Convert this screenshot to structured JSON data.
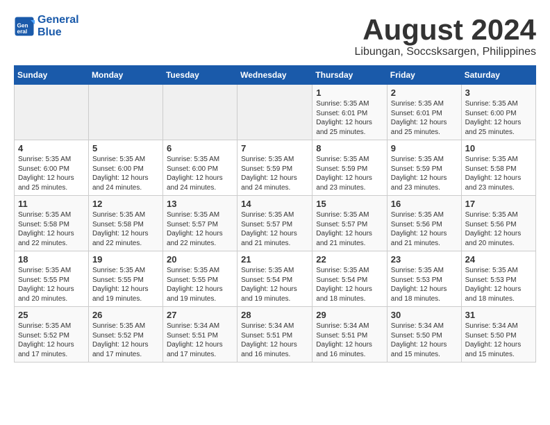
{
  "header": {
    "logo_line1": "General",
    "logo_line2": "Blue",
    "title": "August 2024",
    "subtitle": "Libungan, Soccsksargen, Philippines"
  },
  "weekdays": [
    "Sunday",
    "Monday",
    "Tuesday",
    "Wednesday",
    "Thursday",
    "Friday",
    "Saturday"
  ],
  "weeks": [
    [
      {
        "day": "",
        "info": ""
      },
      {
        "day": "",
        "info": ""
      },
      {
        "day": "",
        "info": ""
      },
      {
        "day": "",
        "info": ""
      },
      {
        "day": "1",
        "info": "Sunrise: 5:35 AM\nSunset: 6:01 PM\nDaylight: 12 hours\nand 25 minutes."
      },
      {
        "day": "2",
        "info": "Sunrise: 5:35 AM\nSunset: 6:01 PM\nDaylight: 12 hours\nand 25 minutes."
      },
      {
        "day": "3",
        "info": "Sunrise: 5:35 AM\nSunset: 6:00 PM\nDaylight: 12 hours\nand 25 minutes."
      }
    ],
    [
      {
        "day": "4",
        "info": "Sunrise: 5:35 AM\nSunset: 6:00 PM\nDaylight: 12 hours\nand 25 minutes."
      },
      {
        "day": "5",
        "info": "Sunrise: 5:35 AM\nSunset: 6:00 PM\nDaylight: 12 hours\nand 24 minutes."
      },
      {
        "day": "6",
        "info": "Sunrise: 5:35 AM\nSunset: 6:00 PM\nDaylight: 12 hours\nand 24 minutes."
      },
      {
        "day": "7",
        "info": "Sunrise: 5:35 AM\nSunset: 5:59 PM\nDaylight: 12 hours\nand 24 minutes."
      },
      {
        "day": "8",
        "info": "Sunrise: 5:35 AM\nSunset: 5:59 PM\nDaylight: 12 hours\nand 23 minutes."
      },
      {
        "day": "9",
        "info": "Sunrise: 5:35 AM\nSunset: 5:59 PM\nDaylight: 12 hours\nand 23 minutes."
      },
      {
        "day": "10",
        "info": "Sunrise: 5:35 AM\nSunset: 5:58 PM\nDaylight: 12 hours\nand 23 minutes."
      }
    ],
    [
      {
        "day": "11",
        "info": "Sunrise: 5:35 AM\nSunset: 5:58 PM\nDaylight: 12 hours\nand 22 minutes."
      },
      {
        "day": "12",
        "info": "Sunrise: 5:35 AM\nSunset: 5:58 PM\nDaylight: 12 hours\nand 22 minutes."
      },
      {
        "day": "13",
        "info": "Sunrise: 5:35 AM\nSunset: 5:57 PM\nDaylight: 12 hours\nand 22 minutes."
      },
      {
        "day": "14",
        "info": "Sunrise: 5:35 AM\nSunset: 5:57 PM\nDaylight: 12 hours\nand 21 minutes."
      },
      {
        "day": "15",
        "info": "Sunrise: 5:35 AM\nSunset: 5:57 PM\nDaylight: 12 hours\nand 21 minutes."
      },
      {
        "day": "16",
        "info": "Sunrise: 5:35 AM\nSunset: 5:56 PM\nDaylight: 12 hours\nand 21 minutes."
      },
      {
        "day": "17",
        "info": "Sunrise: 5:35 AM\nSunset: 5:56 PM\nDaylight: 12 hours\nand 20 minutes."
      }
    ],
    [
      {
        "day": "18",
        "info": "Sunrise: 5:35 AM\nSunset: 5:55 PM\nDaylight: 12 hours\nand 20 minutes."
      },
      {
        "day": "19",
        "info": "Sunrise: 5:35 AM\nSunset: 5:55 PM\nDaylight: 12 hours\nand 19 minutes."
      },
      {
        "day": "20",
        "info": "Sunrise: 5:35 AM\nSunset: 5:55 PM\nDaylight: 12 hours\nand 19 minutes."
      },
      {
        "day": "21",
        "info": "Sunrise: 5:35 AM\nSunset: 5:54 PM\nDaylight: 12 hours\nand 19 minutes."
      },
      {
        "day": "22",
        "info": "Sunrise: 5:35 AM\nSunset: 5:54 PM\nDaylight: 12 hours\nand 18 minutes."
      },
      {
        "day": "23",
        "info": "Sunrise: 5:35 AM\nSunset: 5:53 PM\nDaylight: 12 hours\nand 18 minutes."
      },
      {
        "day": "24",
        "info": "Sunrise: 5:35 AM\nSunset: 5:53 PM\nDaylight: 12 hours\nand 18 minutes."
      }
    ],
    [
      {
        "day": "25",
        "info": "Sunrise: 5:35 AM\nSunset: 5:52 PM\nDaylight: 12 hours\nand 17 minutes."
      },
      {
        "day": "26",
        "info": "Sunrise: 5:35 AM\nSunset: 5:52 PM\nDaylight: 12 hours\nand 17 minutes."
      },
      {
        "day": "27",
        "info": "Sunrise: 5:34 AM\nSunset: 5:51 PM\nDaylight: 12 hours\nand 17 minutes."
      },
      {
        "day": "28",
        "info": "Sunrise: 5:34 AM\nSunset: 5:51 PM\nDaylight: 12 hours\nand 16 minutes."
      },
      {
        "day": "29",
        "info": "Sunrise: 5:34 AM\nSunset: 5:51 PM\nDaylight: 12 hours\nand 16 minutes."
      },
      {
        "day": "30",
        "info": "Sunrise: 5:34 AM\nSunset: 5:50 PM\nDaylight: 12 hours\nand 15 minutes."
      },
      {
        "day": "31",
        "info": "Sunrise: 5:34 AM\nSunset: 5:50 PM\nDaylight: 12 hours\nand 15 minutes."
      }
    ]
  ]
}
